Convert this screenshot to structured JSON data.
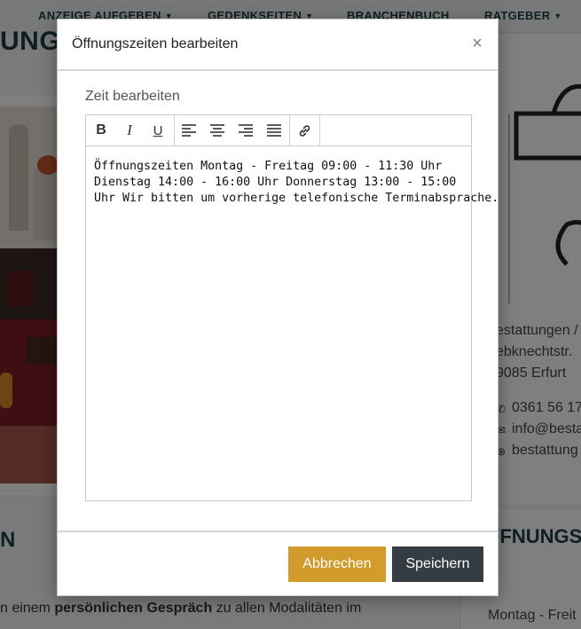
{
  "nav": {
    "items": [
      {
        "label": "ANZEIGE AUFGEBEN"
      },
      {
        "label": "GEDENKSEITEN"
      },
      {
        "label": "BRANCHENBUCH"
      },
      {
        "label": "RATGEBER"
      }
    ]
  },
  "background": {
    "left_heading_top": "UNGE",
    "left_heading_bottom": "N",
    "left_text_pre": "n einem ",
    "left_text_bold": "persönlichen Gespräch",
    "left_text_post": " zu allen Modalitäten im",
    "right_lines": [
      "estattungen /",
      "ebknechtstr.",
      "9085 Erfurt"
    ],
    "contact": {
      "phone": "0361 56 17",
      "email": "info@besta",
      "web": "bestattung"
    },
    "right_heading": "FFNUNGSZ",
    "right_bottom_text": "Montag - Freit"
  },
  "modal": {
    "title": "Öffnungszeiten bearbeiten",
    "close_label": "×",
    "field_label": "Zeit bearbeiten",
    "toolbar": {
      "bold": "B",
      "italic": "I",
      "underline": "U"
    },
    "editor_text": "Öffnungszeiten Montag - Freitag 09:00 - 11:30 Uhr\nDienstag 14:00 - 16:00 Uhr Donnerstag 13:00 - 15:00\nUhr Wir bitten um vorherige telefonische Terminabsprache.",
    "cancel_label": "Abbrechen",
    "save_label": "Speichern"
  },
  "colors": {
    "cancel_button": "#d19c2c",
    "save_button": "#343d44",
    "heading": "#1d3e46"
  }
}
